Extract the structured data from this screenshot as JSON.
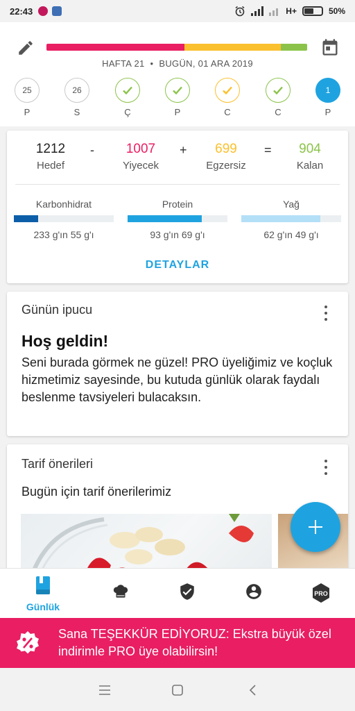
{
  "status_bar": {
    "time": "22:43",
    "network": "H+",
    "battery": "50%",
    "battery_level": 0.5
  },
  "header": {
    "week_label": "HAFTA 21",
    "separator": "•",
    "date_label": "BUGÜN, 01 ARA 2019",
    "progress_segments": [
      {
        "color": "#e91e63",
        "fraction": 0.53
      },
      {
        "color": "#fbc02d",
        "fraction": 0.37
      },
      {
        "color": "#8bc34a",
        "fraction": 0.1
      }
    ],
    "days": [
      {
        "label": "P",
        "value": "25",
        "state": "plain"
      },
      {
        "label": "S",
        "value": "26",
        "state": "plain"
      },
      {
        "label": "Ç",
        "value": "",
        "state": "check-green"
      },
      {
        "label": "P",
        "value": "",
        "state": "check-green"
      },
      {
        "label": "C",
        "value": "",
        "state": "check-yellow"
      },
      {
        "label": "C",
        "value": "",
        "state": "check-green"
      },
      {
        "label": "P",
        "value": "1",
        "state": "today"
      }
    ]
  },
  "summary": {
    "goal": {
      "value": "1212",
      "label": "Hedef"
    },
    "minus": "-",
    "food": {
      "value": "1007",
      "label": "Yiyecek"
    },
    "plus": "+",
    "exercise": {
      "value": "699",
      "label": "Egzersiz"
    },
    "equals": "=",
    "remaining": {
      "value": "904",
      "label": "Kalan"
    },
    "macros": [
      {
        "name": "Karbonhidrat",
        "text": "233 g'ın 55 g'ı",
        "fraction": 0.24,
        "color": "#0d5ea8"
      },
      {
        "name": "Protein",
        "text": "93 g'ın 69 g'ı",
        "fraction": 0.74,
        "color": "#1fa3e0"
      },
      {
        "name": "Yağ",
        "text": "62 g'ın 49 g'ı",
        "fraction": 0.79,
        "color": "#b3e0f7"
      }
    ],
    "details_button": "DETAYLAR"
  },
  "tip": {
    "title": "Günün ipucu",
    "heading": "Hoş geldin!",
    "body": "Seni burada görmek ne güzel! PRO üyeliğimiz ve koçluk hizmetimiz sayesinde, bu kutuda günlük olarak faydalı beslenme tavsiyeleri bulacaksın."
  },
  "recipes": {
    "title": "Tarif önerileri",
    "subtitle": "Bugün için tarif önerilerimiz"
  },
  "bottom_nav": {
    "items": [
      {
        "label": "Günlük",
        "icon": "diary-icon",
        "active": true
      },
      {
        "label": "",
        "icon": "chef-hat-icon",
        "active": false
      },
      {
        "label": "",
        "icon": "shield-check-icon",
        "active": false
      },
      {
        "label": "",
        "icon": "account-icon",
        "active": false
      },
      {
        "label": "",
        "icon": "pro-badge-icon",
        "active": false
      }
    ],
    "pro_badge_text": "PRO"
  },
  "promo": {
    "text": "Sana TEŞEKKÜR EDİYORUZ: Ekstra büyük özel indirimle PRO üye olabilirsin!"
  },
  "colors": {
    "accent": "#1fa3e0",
    "food": "#e91e63",
    "exercise": "#fbc02d",
    "remaining": "#8bc34a",
    "promo": "#e91e63"
  }
}
